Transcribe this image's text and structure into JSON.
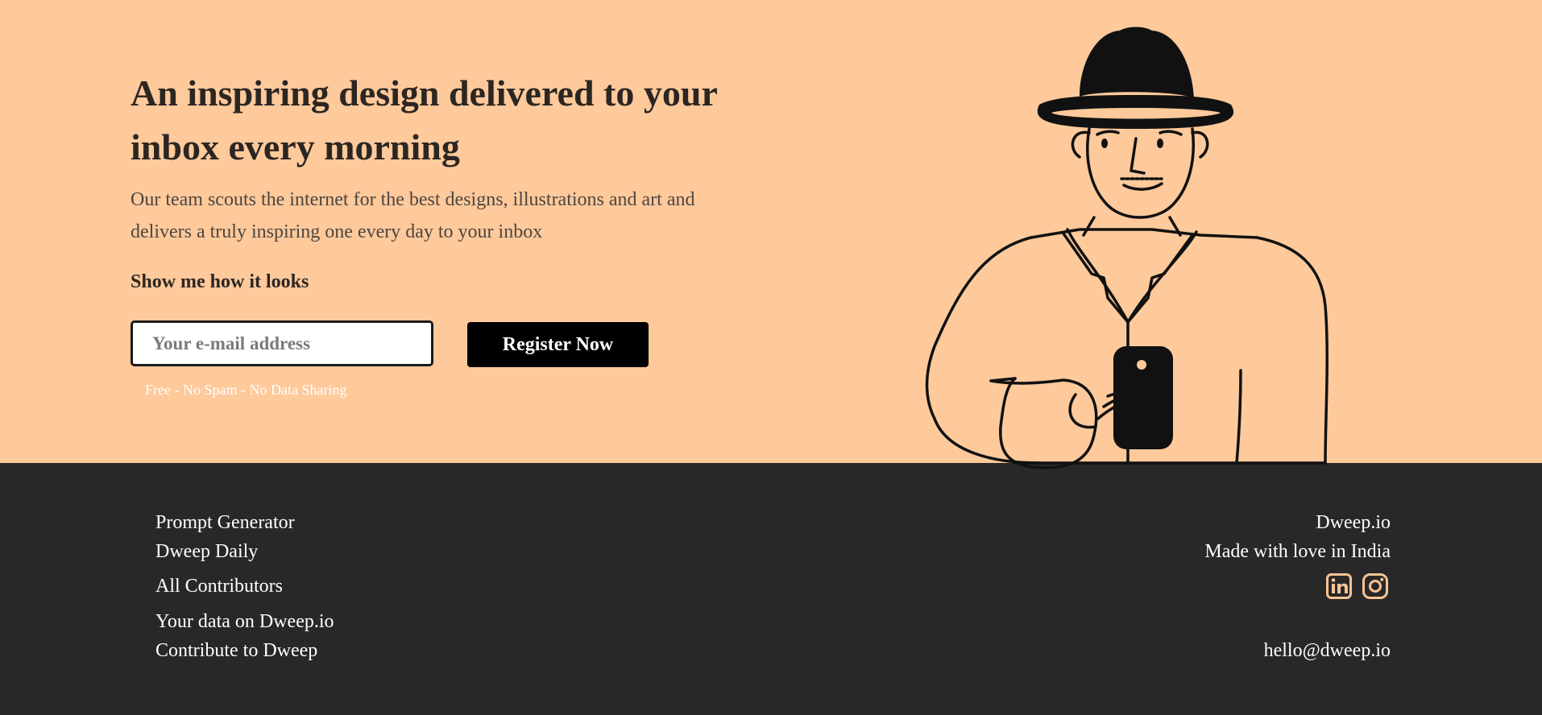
{
  "hero": {
    "title": "An inspiring design delivered to your inbox every morning",
    "description": "Our team scouts the internet for the best designs, illustrations and art and delivers a truly inspiring one every day to your inbox",
    "cta_heading": "Show me how it looks",
    "email_placeholder": "Your e-mail address",
    "register_label": "Register Now",
    "note": "Free - No Spam - No Data Sharing"
  },
  "footer": {
    "links": [
      {
        "label": "Prompt Generator"
      },
      {
        "label": "Dweep Daily"
      },
      {
        "label": "All Contributors"
      },
      {
        "label": "Your data on Dweep.io"
      },
      {
        "label": "Contribute to Dweep"
      }
    ],
    "brand": "Dweep.io",
    "tagline": "Made with love in India",
    "social": [
      {
        "icon": "linkedin-icon"
      },
      {
        "icon": "instagram-icon"
      }
    ],
    "email": "hello@dweep.io"
  },
  "colors": {
    "hero_bg": "#fec99b",
    "footer_bg": "#282828",
    "accent": "#f6c495",
    "button_bg": "#000000"
  }
}
